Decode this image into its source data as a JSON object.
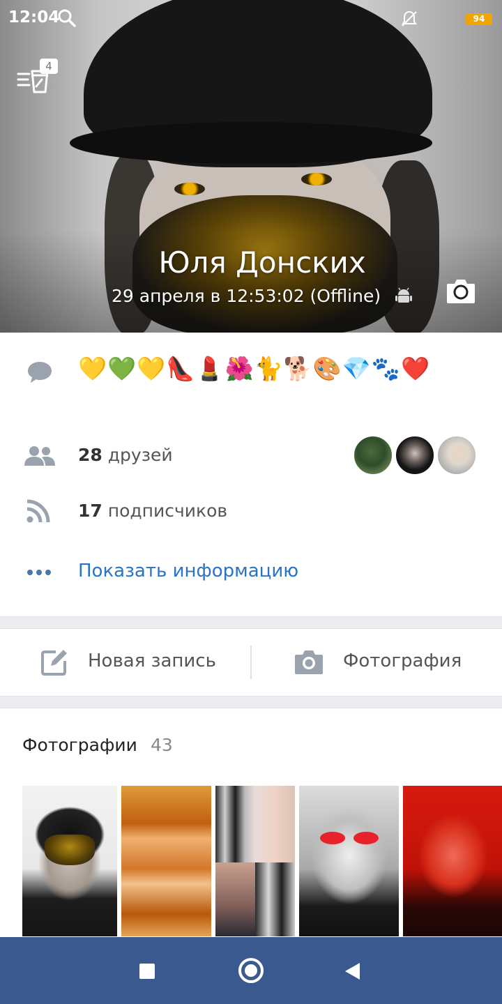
{
  "status_bar": {
    "time": "12:04",
    "battery": "94"
  },
  "stories": {
    "badge": "4"
  },
  "profile": {
    "name": "Юля Донских",
    "last_seen": "29 апреля в 12:53:02 (Offline)"
  },
  "bio": {
    "emoji": "💛💚💛👠💄🌺🐈🐕🎨💎🐾❤️"
  },
  "friends": {
    "count": "28",
    "label": "друзей"
  },
  "followers": {
    "count": "17",
    "label": "подписчиков"
  },
  "show_info": "Показать информацию",
  "actions": {
    "new_post": "Новая запись",
    "photo": "Фотография"
  },
  "photos": {
    "title": "Фотографии",
    "count": "43"
  },
  "colors": {
    "link": "#2a73c7",
    "navbar": "#3a5a8f",
    "icon": "#99a2ad",
    "battery": "#f2a400"
  }
}
